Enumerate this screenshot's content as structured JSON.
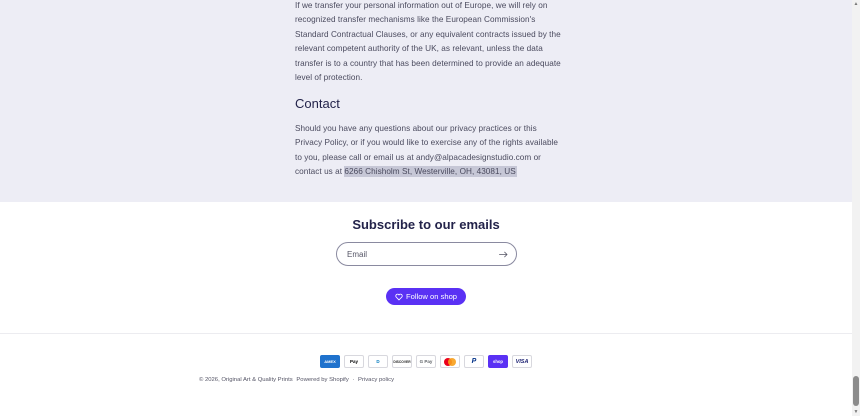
{
  "policy": {
    "transfer_paragraph": "If we transfer your personal information out of Europe, we will rely on recognized transfer mechanisms like the European Commission's Standard Contractual Clauses, or any equivalent contracts issued by the relevant competent authority of the UK, as relevant, unless the data transfer is to a country that has been determined to provide an adequate level of protection.",
    "contact_heading": "Contact",
    "contact_text": "Should you have any questions about our privacy practices or this Privacy Policy, or if you would like to exercise any of the rights available to you, please call or email us at andy@alpacadesignstudio.com or contact us at ",
    "contact_address": "6266 Chisholm St, Westerville, OH, 43081, US"
  },
  "newsletter": {
    "title": "Subscribe to our emails",
    "email_placeholder": "Email",
    "follow_label": "Follow on shop"
  },
  "payment_methods": [
    {
      "name": "American Express",
      "label": "AMEX",
      "icon": "amex-icon"
    },
    {
      "name": "Apple Pay",
      "label": "Pay",
      "icon": "apple-pay-icon"
    },
    {
      "name": "Diners Club",
      "label": "D",
      "icon": "diners-club-icon"
    },
    {
      "name": "Discover",
      "label": "DISCOVER",
      "icon": "discover-icon"
    },
    {
      "name": "Google Pay",
      "label": "G Pay",
      "icon": "google-pay-icon"
    },
    {
      "name": "Mastercard",
      "label": "",
      "icon": "mastercard-icon"
    },
    {
      "name": "PayPal",
      "label": "P",
      "icon": "paypal-icon"
    },
    {
      "name": "Shop Pay",
      "label": "shop",
      "icon": "shop-pay-icon"
    },
    {
      "name": "Visa",
      "label": "VISA",
      "icon": "visa-icon"
    }
  ],
  "footer": {
    "copyright": "© 2026, Original Art & Quality Prints",
    "powered_by": "Powered by Shopify",
    "separator": "·",
    "privacy_link": "Privacy policy"
  },
  "colors": {
    "policy_background": "#ededf5",
    "heading_text": "#23234a",
    "shop_purple": "#5a31f4",
    "highlight": "#c6c7d6"
  }
}
